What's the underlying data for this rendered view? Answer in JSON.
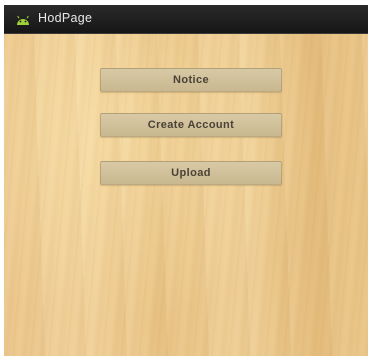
{
  "app": {
    "title": "HodPage",
    "icon": "android-icon",
    "icon_color": "#9fd13a"
  },
  "menu": {
    "notice_label": "Notice",
    "create_account_label": "Create Account",
    "upload_label": "Upload"
  }
}
